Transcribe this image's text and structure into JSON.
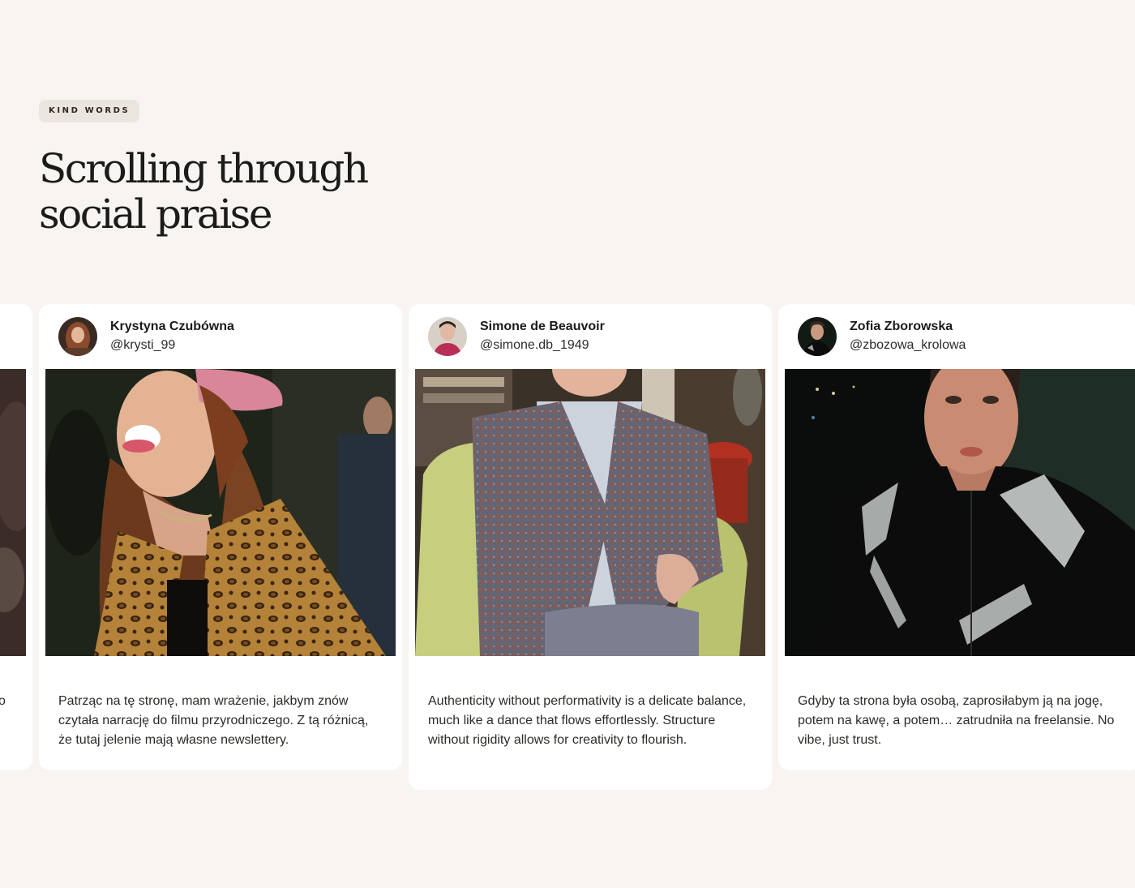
{
  "section": {
    "eyebrow": "KIND WORDS",
    "heading": "Scrolling through social praise"
  },
  "testimonials": [
    {
      "name": "",
      "handle": "",
      "quote": "o",
      "avatar_icon": "avatar-photo-partial",
      "photo_icon": "dark-fur-photo"
    },
    {
      "name": "Krystyna Czubówna",
      "handle": "@krysti_99",
      "quote": "Patrząc na tę stronę, mam wrażenie, jakbym znów czytała narrację do filmu przyrodniczego. Z tą różnicą, że tutaj jelenie mają własne newslettery.",
      "avatar_icon": "avatar-woman-auburn-hair",
      "photo_icon": "woman-pink-beret-leopard-coat-photo"
    },
    {
      "name": "Simone de Beauvoir",
      "handle": "@simone.db_1949",
      "quote": "Authenticity without performativity is a delicate balance, much like a dance that flows effortlessly. Structure without rigidity allows for creativity to flourish.",
      "avatar_icon": "avatar-woman-red-top",
      "photo_icon": "woman-tweed-cardigan-armchair-photo"
    },
    {
      "name": "Zofia Zborowska",
      "handle": "@zbozowa_krolowa",
      "quote": "Gdyby ta strona była osobą, zaprosiłabym ją na jogę, potem na kawę, a potem… zatrudniła na freelansie. No vibe, just trust.",
      "avatar_icon": "avatar-woman-dark-jacket",
      "photo_icon": "woman-black-silver-jacket-photo"
    }
  ]
}
